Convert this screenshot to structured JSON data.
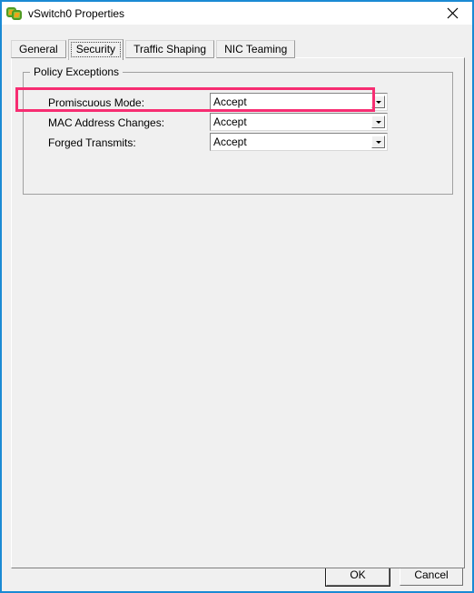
{
  "window": {
    "title": "vSwitch0 Properties",
    "icon": "vswitch-icon",
    "close_label": "✕",
    "border_color": "#1a8ad4"
  },
  "tabs": [
    {
      "label": "General",
      "selected": false
    },
    {
      "label": "Security",
      "selected": true
    },
    {
      "label": "Traffic Shaping",
      "selected": false
    },
    {
      "label": "NIC Teaming",
      "selected": false
    }
  ],
  "group": {
    "title": "Policy Exceptions",
    "rows": [
      {
        "label": "Promiscuous Mode:",
        "value": "Accept",
        "highlighted": true
      },
      {
        "label": "MAC Address Changes:",
        "value": "Accept",
        "highlighted": false
      },
      {
        "label": "Forged Transmits:",
        "value": "Accept",
        "highlighted": false
      }
    ]
  },
  "highlight": {
    "color": "#f72d72"
  },
  "footer": {
    "ok_label": "OK",
    "cancel_label": "Cancel"
  }
}
